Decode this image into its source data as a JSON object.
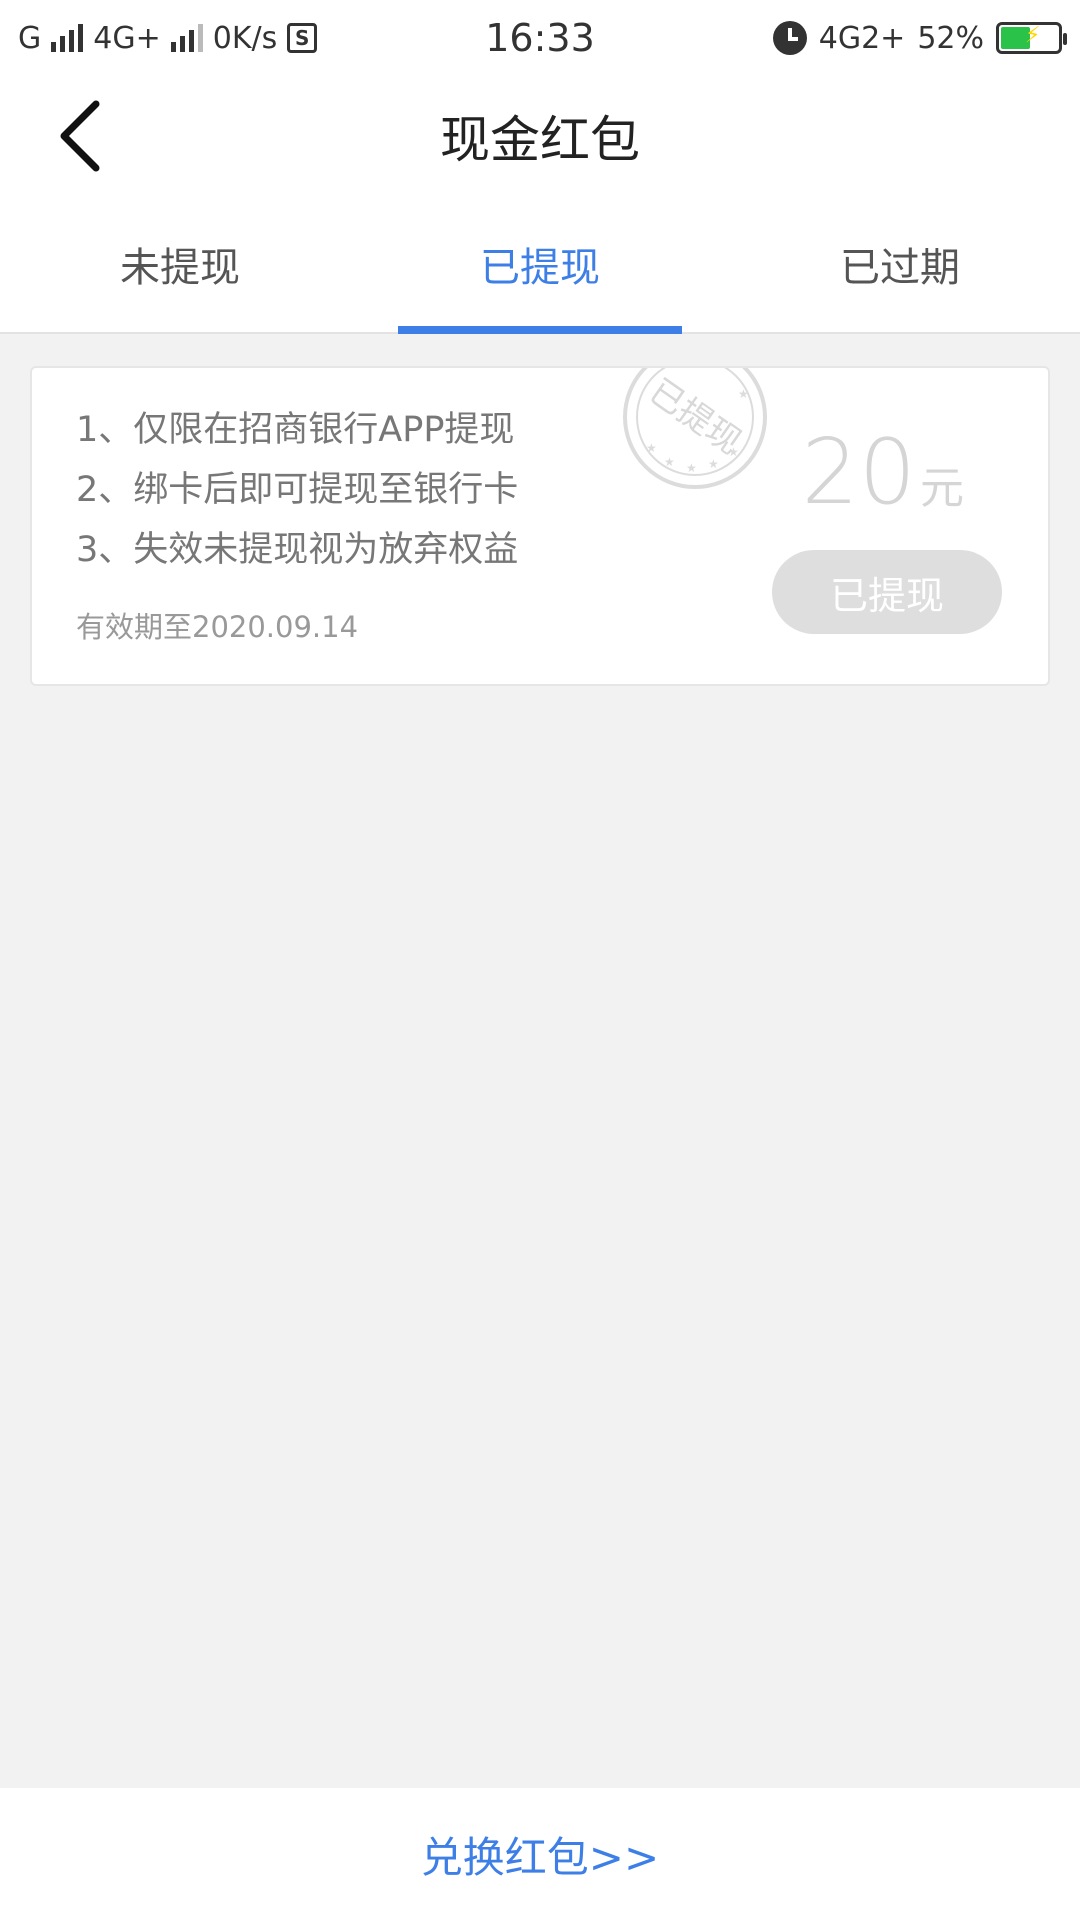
{
  "status_bar": {
    "carrier1": "G",
    "carrier2": "4G+",
    "speed": "0K/s",
    "sim_icon_letter": "S",
    "time": "16:33",
    "network": "4G2+",
    "battery": "52%",
    "battery_level": 0.52
  },
  "header": {
    "title": "现金红包",
    "back_icon": "chevron-left-icon"
  },
  "tabs": [
    {
      "label": "未提现",
      "active": false
    },
    {
      "label": "已提现",
      "active": true
    },
    {
      "label": "已过期",
      "active": false
    }
  ],
  "card": {
    "rules": [
      "1、仅限在招商银行APP提现",
      "2、绑卡后即可提现至银行卡",
      "3、失效未提现视为放弃权益"
    ],
    "validity": "有效期至2020.09.14",
    "amount": "20",
    "unit": "元",
    "status_button": "已提现",
    "stamp_text": "已提现"
  },
  "footer": {
    "exchange_link": "兑换红包>>"
  },
  "colors": {
    "accent": "#3d7fe6",
    "background": "#f2f2f2",
    "battery": "#2bc24a"
  }
}
